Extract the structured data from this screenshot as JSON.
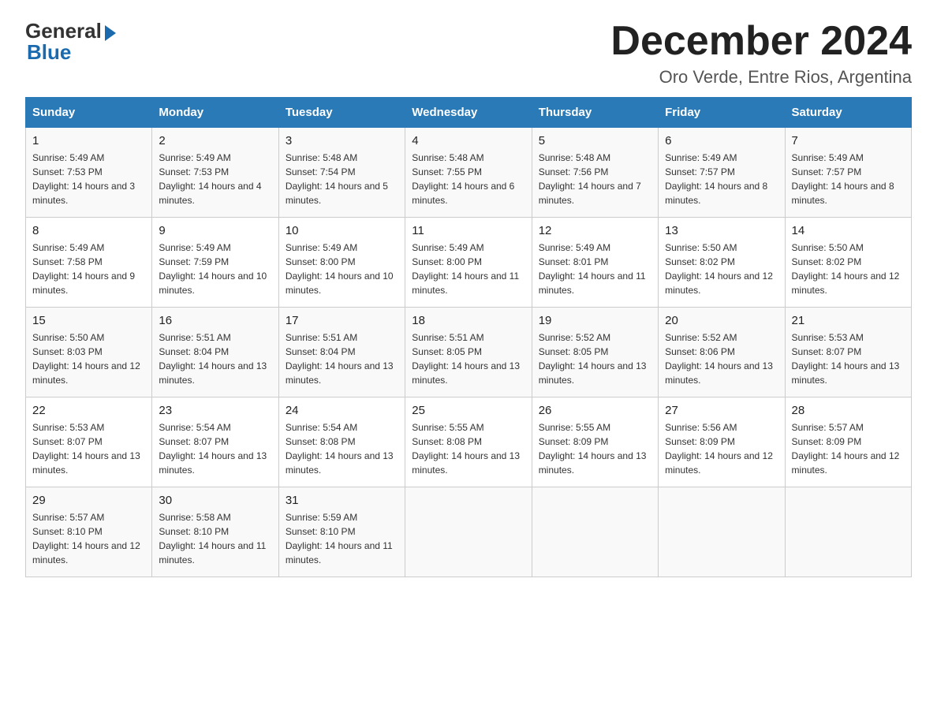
{
  "logo": {
    "general": "General",
    "blue": "Blue"
  },
  "title": "December 2024",
  "subtitle": "Oro Verde, Entre Rios, Argentina",
  "headers": [
    "Sunday",
    "Monday",
    "Tuesday",
    "Wednesday",
    "Thursday",
    "Friday",
    "Saturday"
  ],
  "weeks": [
    [
      {
        "num": "1",
        "sunrise": "5:49 AM",
        "sunset": "7:53 PM",
        "daylight": "14 hours and 3 minutes."
      },
      {
        "num": "2",
        "sunrise": "5:49 AM",
        "sunset": "7:53 PM",
        "daylight": "14 hours and 4 minutes."
      },
      {
        "num": "3",
        "sunrise": "5:48 AM",
        "sunset": "7:54 PM",
        "daylight": "14 hours and 5 minutes."
      },
      {
        "num": "4",
        "sunrise": "5:48 AM",
        "sunset": "7:55 PM",
        "daylight": "14 hours and 6 minutes."
      },
      {
        "num": "5",
        "sunrise": "5:48 AM",
        "sunset": "7:56 PM",
        "daylight": "14 hours and 7 minutes."
      },
      {
        "num": "6",
        "sunrise": "5:49 AM",
        "sunset": "7:57 PM",
        "daylight": "14 hours and 8 minutes."
      },
      {
        "num": "7",
        "sunrise": "5:49 AM",
        "sunset": "7:57 PM",
        "daylight": "14 hours and 8 minutes."
      }
    ],
    [
      {
        "num": "8",
        "sunrise": "5:49 AM",
        "sunset": "7:58 PM",
        "daylight": "14 hours and 9 minutes."
      },
      {
        "num": "9",
        "sunrise": "5:49 AM",
        "sunset": "7:59 PM",
        "daylight": "14 hours and 10 minutes."
      },
      {
        "num": "10",
        "sunrise": "5:49 AM",
        "sunset": "8:00 PM",
        "daylight": "14 hours and 10 minutes."
      },
      {
        "num": "11",
        "sunrise": "5:49 AM",
        "sunset": "8:00 PM",
        "daylight": "14 hours and 11 minutes."
      },
      {
        "num": "12",
        "sunrise": "5:49 AM",
        "sunset": "8:01 PM",
        "daylight": "14 hours and 11 minutes."
      },
      {
        "num": "13",
        "sunrise": "5:50 AM",
        "sunset": "8:02 PM",
        "daylight": "14 hours and 12 minutes."
      },
      {
        "num": "14",
        "sunrise": "5:50 AM",
        "sunset": "8:02 PM",
        "daylight": "14 hours and 12 minutes."
      }
    ],
    [
      {
        "num": "15",
        "sunrise": "5:50 AM",
        "sunset": "8:03 PM",
        "daylight": "14 hours and 12 minutes."
      },
      {
        "num": "16",
        "sunrise": "5:51 AM",
        "sunset": "8:04 PM",
        "daylight": "14 hours and 13 minutes."
      },
      {
        "num": "17",
        "sunrise": "5:51 AM",
        "sunset": "8:04 PM",
        "daylight": "14 hours and 13 minutes."
      },
      {
        "num": "18",
        "sunrise": "5:51 AM",
        "sunset": "8:05 PM",
        "daylight": "14 hours and 13 minutes."
      },
      {
        "num": "19",
        "sunrise": "5:52 AM",
        "sunset": "8:05 PM",
        "daylight": "14 hours and 13 minutes."
      },
      {
        "num": "20",
        "sunrise": "5:52 AM",
        "sunset": "8:06 PM",
        "daylight": "14 hours and 13 minutes."
      },
      {
        "num": "21",
        "sunrise": "5:53 AM",
        "sunset": "8:07 PM",
        "daylight": "14 hours and 13 minutes."
      }
    ],
    [
      {
        "num": "22",
        "sunrise": "5:53 AM",
        "sunset": "8:07 PM",
        "daylight": "14 hours and 13 minutes."
      },
      {
        "num": "23",
        "sunrise": "5:54 AM",
        "sunset": "8:07 PM",
        "daylight": "14 hours and 13 minutes."
      },
      {
        "num": "24",
        "sunrise": "5:54 AM",
        "sunset": "8:08 PM",
        "daylight": "14 hours and 13 minutes."
      },
      {
        "num": "25",
        "sunrise": "5:55 AM",
        "sunset": "8:08 PM",
        "daylight": "14 hours and 13 minutes."
      },
      {
        "num": "26",
        "sunrise": "5:55 AM",
        "sunset": "8:09 PM",
        "daylight": "14 hours and 13 minutes."
      },
      {
        "num": "27",
        "sunrise": "5:56 AM",
        "sunset": "8:09 PM",
        "daylight": "14 hours and 12 minutes."
      },
      {
        "num": "28",
        "sunrise": "5:57 AM",
        "sunset": "8:09 PM",
        "daylight": "14 hours and 12 minutes."
      }
    ],
    [
      {
        "num": "29",
        "sunrise": "5:57 AM",
        "sunset": "8:10 PM",
        "daylight": "14 hours and 12 minutes."
      },
      {
        "num": "30",
        "sunrise": "5:58 AM",
        "sunset": "8:10 PM",
        "daylight": "14 hours and 11 minutes."
      },
      {
        "num": "31",
        "sunrise": "5:59 AM",
        "sunset": "8:10 PM",
        "daylight": "14 hours and 11 minutes."
      },
      null,
      null,
      null,
      null
    ]
  ]
}
